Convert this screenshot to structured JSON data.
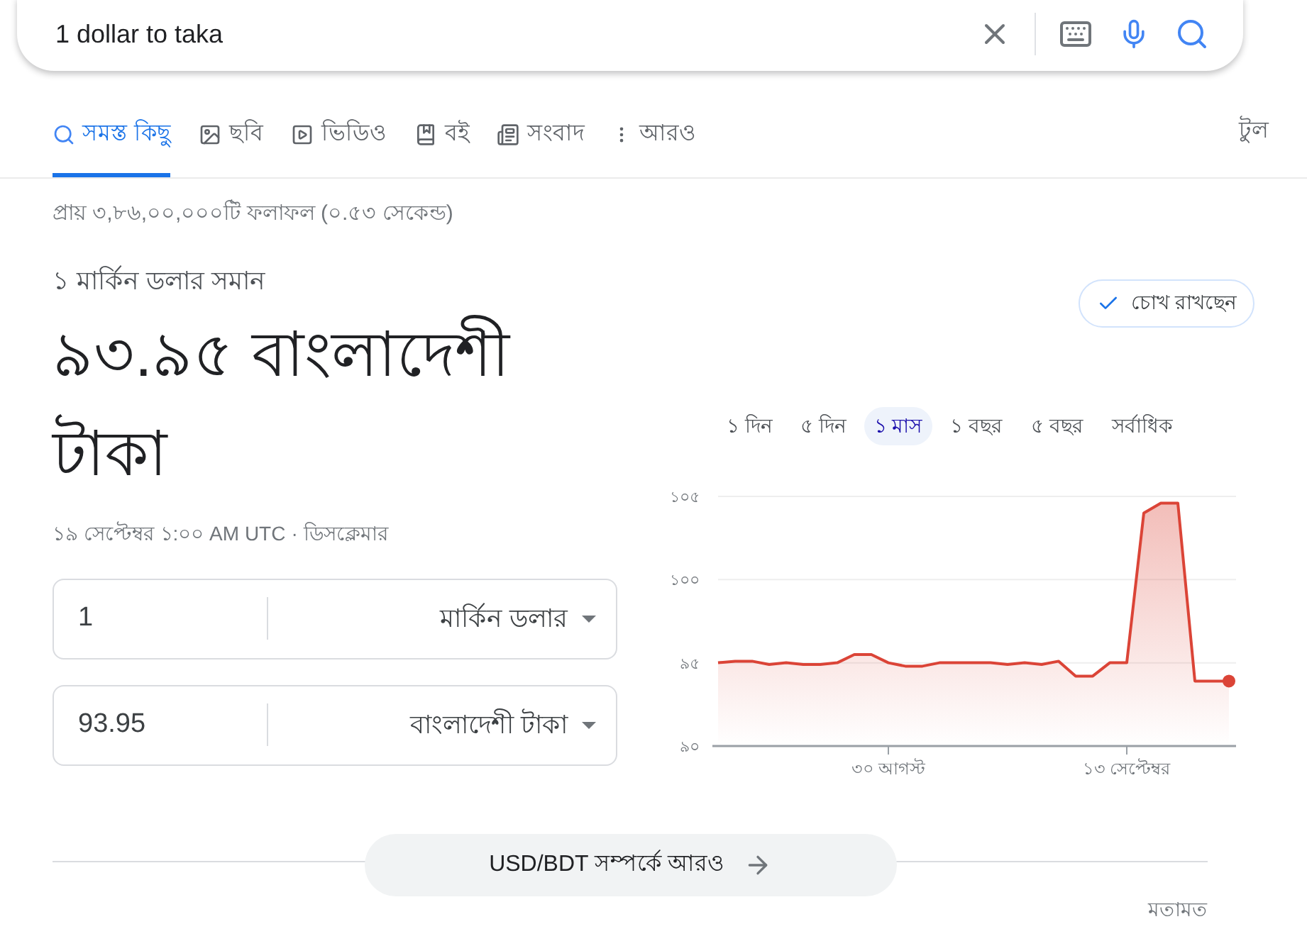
{
  "search": {
    "query": "1 dollar to taka"
  },
  "tabs": [
    {
      "label": "সমস্ত কিছু",
      "selected": true
    },
    {
      "label": "ছবি",
      "selected": false
    },
    {
      "label": "ভিডিও",
      "selected": false
    },
    {
      "label": "বই",
      "selected": false
    },
    {
      "label": "সংবাদ",
      "selected": false
    },
    {
      "label": "আরও",
      "selected": false
    }
  ],
  "tools": "টুল",
  "result_stats": "প্রায় ৩,৮৬,০০,০০০টি ফলাফল (০.৫৩ সেকেন্ড)",
  "converter": {
    "subtitle": "১ মার্কিন ডলার সমান",
    "result": "৯৩.৯৫ বাংলাদেশী টাকা",
    "timestamp": "১৯ সেপ্টেম্বর ১:০০ AM UTC",
    "separator": "·",
    "disclaimer": "ডিসক্লেমার",
    "fields": [
      {
        "value": "1",
        "currency": "মার্কিন ডলার"
      },
      {
        "value": "93.95",
        "currency": "বাংলাদেশী টাকা"
      }
    ]
  },
  "watch_button": {
    "label": "চোখ রাখছেন",
    "on": true
  },
  "ranges": [
    {
      "label": "১ দিন",
      "selected": false
    },
    {
      "label": "৫ দিন",
      "selected": false
    },
    {
      "label": "১ মাস",
      "selected": true
    },
    {
      "label": "১ বছর",
      "selected": false
    },
    {
      "label": "৫ বছর",
      "selected": false
    },
    {
      "label": "সর্বাধিক",
      "selected": false
    }
  ],
  "date_labels": [
    "৩০ আগস্ট",
    "১৩ সেপ্টেম্বর"
  ],
  "chart_data": {
    "type": "area",
    "series": [
      {
        "color": "#db4437",
        "values": [
          95.0,
          95.1,
          95.1,
          94.9,
          95.0,
          94.9,
          94.9,
          95.0,
          95.5,
          95.5,
          95.0,
          94.8,
          94.8,
          95.0,
          95.0,
          95.0,
          95.0,
          94.9,
          95.0,
          94.9,
          95.1,
          94.2,
          94.2,
          95.0,
          95.0,
          104.0,
          104.6,
          104.6,
          93.9,
          93.9,
          93.9
        ]
      }
    ],
    "ylim": [
      90,
      105
    ],
    "yticks": [
      {
        "value": 90,
        "label": "৯০"
      },
      {
        "value": 95,
        "label": "৯৫"
      },
      {
        "value": 100,
        "label": "১০০"
      },
      {
        "value": 105,
        "label": "১০৫"
      }
    ]
  },
  "more_button": "USD/BDT সম্পর্কে আরও",
  "feedback": "মতামত"
}
